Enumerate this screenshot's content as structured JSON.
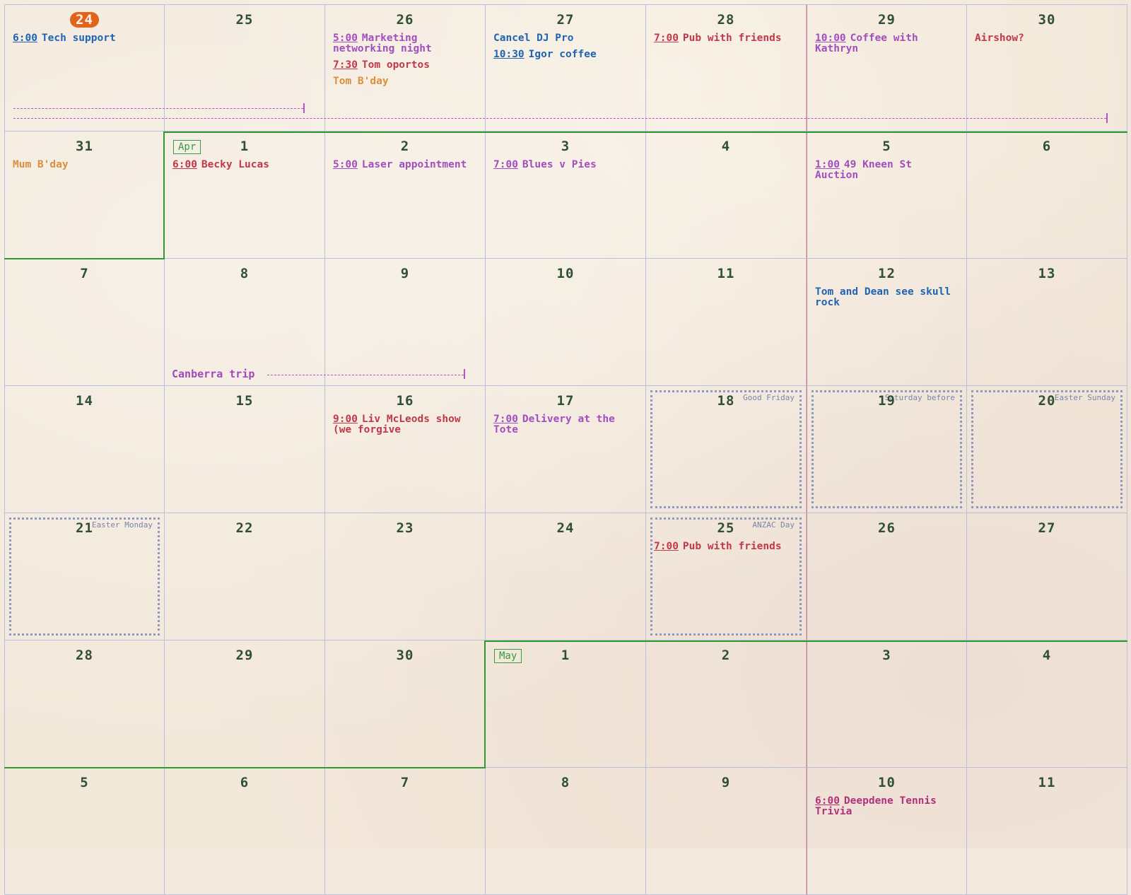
{
  "calendar": {
    "weeks": [
      [
        {
          "day": "24",
          "today": true,
          "events": [
            {
              "time": "6:00",
              "text": "Tech support",
              "color": "#1f63b4"
            }
          ]
        },
        {
          "day": "25",
          "events": []
        },
        {
          "day": "26",
          "events": [
            {
              "time": "5:00",
              "text": "Marketing networking night",
              "color": "#a24ebe"
            },
            {
              "time": "7:30",
              "text": "Tom oportos",
              "color": "#c0394a"
            },
            {
              "time": "",
              "text": "Tom B'day",
              "color": "#dd8e3c"
            }
          ]
        },
        {
          "day": "27",
          "events": [
            {
              "time": "",
              "text": "Cancel DJ Pro",
              "color": "#1f63b4"
            },
            {
              "time": "10:30",
              "text": "Igor coffee",
              "color": "#1f63b4"
            }
          ]
        },
        {
          "day": "28",
          "events": [
            {
              "time": "7:00",
              "text": "Pub with friends",
              "color": "#c0394a"
            }
          ]
        },
        {
          "day": "29",
          "events": [
            {
              "time": "10:00",
              "text": "Coffee with Kathryn",
              "color": "#a24ebe"
            }
          ]
        },
        {
          "day": "30",
          "events": [
            {
              "time": "",
              "text": "Airshow?",
              "color": "#c0394a"
            }
          ]
        }
      ],
      [
        {
          "day": "31",
          "events": [
            {
              "time": "",
              "text": "Mum B'day",
              "color": "#dd8e3c"
            }
          ]
        },
        {
          "day": "1",
          "month_tag": "Apr",
          "events": [
            {
              "time": "6:00",
              "text": "Becky Lucas",
              "color": "#c0394a"
            }
          ]
        },
        {
          "day": "2",
          "events": [
            {
              "time": "5:00",
              "text": "Laser appointment",
              "color": "#a24ebe"
            }
          ]
        },
        {
          "day": "3",
          "events": [
            {
              "time": "7:00",
              "text": "Blues v Pies",
              "color": "#a24ebe"
            }
          ]
        },
        {
          "day": "4",
          "events": []
        },
        {
          "day": "5",
          "events": [
            {
              "time": "1:00",
              "text": "49 Kneen St Auction",
              "color": "#a24ebe"
            }
          ]
        },
        {
          "day": "6",
          "events": []
        }
      ],
      [
        {
          "day": "7",
          "events": []
        },
        {
          "day": "8",
          "events": []
        },
        {
          "day": "9",
          "events": []
        },
        {
          "day": "10",
          "events": []
        },
        {
          "day": "11",
          "events": []
        },
        {
          "day": "12",
          "events": [
            {
              "time": "",
              "text": "Tom and Dean see skull rock",
              "color": "#1f63b4"
            }
          ]
        },
        {
          "day": "13",
          "events": []
        }
      ],
      [
        {
          "day": "14",
          "events": []
        },
        {
          "day": "15",
          "events": []
        },
        {
          "day": "16",
          "events": [
            {
              "time": "9:00",
              "text": "Liv McLeods show (we forgive",
              "color": "#c0394a"
            }
          ]
        },
        {
          "day": "17",
          "events": [
            {
              "time": "7:00",
              "text": "Delivery at the Tote",
              "color": "#a24ebe"
            }
          ]
        },
        {
          "day": "18",
          "holiday": "Good Friday",
          "events": []
        },
        {
          "day": "19",
          "holiday": "Saturday before",
          "events": []
        },
        {
          "day": "20",
          "holiday": "Easter Sunday",
          "events": []
        }
      ],
      [
        {
          "day": "21",
          "holiday": "Easter Monday",
          "events": []
        },
        {
          "day": "22",
          "events": []
        },
        {
          "day": "23",
          "events": []
        },
        {
          "day": "24",
          "events": []
        },
        {
          "day": "25",
          "holiday": "ANZAC Day",
          "events": [
            {
              "time": "7:00",
              "text": "Pub with friends",
              "color": "#c0394a"
            }
          ]
        },
        {
          "day": "26",
          "events": []
        },
        {
          "day": "27",
          "events": []
        }
      ],
      [
        {
          "day": "28",
          "events": []
        },
        {
          "day": "29",
          "events": []
        },
        {
          "day": "30",
          "events": []
        },
        {
          "day": "1",
          "month_tag": "May",
          "events": []
        },
        {
          "day": "2",
          "events": []
        },
        {
          "day": "3",
          "events": []
        },
        {
          "day": "4",
          "events": []
        }
      ],
      [
        {
          "day": "5",
          "events": []
        },
        {
          "day": "6",
          "events": []
        },
        {
          "day": "7",
          "events": []
        },
        {
          "day": "8",
          "events": []
        },
        {
          "day": "9",
          "events": []
        },
        {
          "day": "10",
          "events": [
            {
              "time": "6:00",
              "text": "Deepdene Tennis Trivia",
              "color": "#b0307c"
            }
          ]
        },
        {
          "day": "11",
          "events": []
        }
      ]
    ],
    "spans": [
      {
        "label": "",
        "color": "#b156c8"
      },
      {
        "label": "",
        "color": "#b156c8"
      },
      {
        "label": "Canberra trip",
        "color": "#a04ab8"
      }
    ],
    "colors": {
      "grid": "#b9c0de",
      "weekend_separator": "#e07a80",
      "month_boundary": "#2e9b2e",
      "today_badge": "#e2641b",
      "day_number": "#2f4f36",
      "paper": "#f2e8da"
    }
  }
}
